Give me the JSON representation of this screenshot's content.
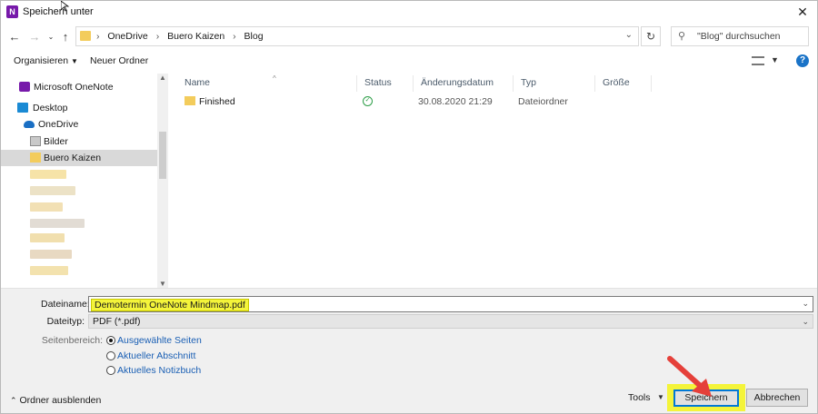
{
  "window": {
    "title": "Speichern unter",
    "app_icon_letter": "N"
  },
  "address": {
    "crumbs": [
      "OneDrive",
      "Buero Kaizen",
      "Blog"
    ],
    "search_placeholder": "\"Blog\" durchsuchen"
  },
  "toolbar": {
    "organize": "Organisieren",
    "new_folder": "Neuer Ordner"
  },
  "nav": {
    "items": [
      {
        "label": "Microsoft OneNote",
        "icon": "onenote-icon"
      },
      {
        "label": "Desktop",
        "icon": "desktop-icon"
      },
      {
        "label": "OneDrive",
        "icon": "onedrive-cloud-icon"
      },
      {
        "label": "Bilder",
        "icon": "pictures-icon"
      },
      {
        "label": "Buero Kaizen",
        "icon": "folder-icon",
        "selected": true
      }
    ]
  },
  "columns": [
    "Name",
    "Status",
    "Änderungsdatum",
    "Typ",
    "Größe"
  ],
  "files": [
    {
      "name": "Finished",
      "status": "synced-check-icon",
      "modified": "30.08.2020 21:29",
      "type": "Dateiordner",
      "size": ""
    }
  ],
  "form": {
    "filename_label": "Dateiname:",
    "filename_value": "Demotermin OneNote Mindmap.pdf",
    "filetype_label": "Dateityp:",
    "filetype_value": "PDF (*.pdf)",
    "range_label": "Seitenbereich:",
    "range_options": [
      {
        "label": "Ausgewählte Seiten",
        "checked": true
      },
      {
        "label": "Aktueller Abschnitt",
        "checked": false
      },
      {
        "label": "Aktuelles Notizbuch",
        "checked": false
      }
    ]
  },
  "footer": {
    "hide_folders": "Ordner ausblenden",
    "tools": "Tools",
    "save": "Speichern",
    "cancel": "Abbrechen"
  },
  "colors": {
    "highlight": "#f4f43a",
    "accent": "#0078d7",
    "arrow": "#e5403a"
  }
}
